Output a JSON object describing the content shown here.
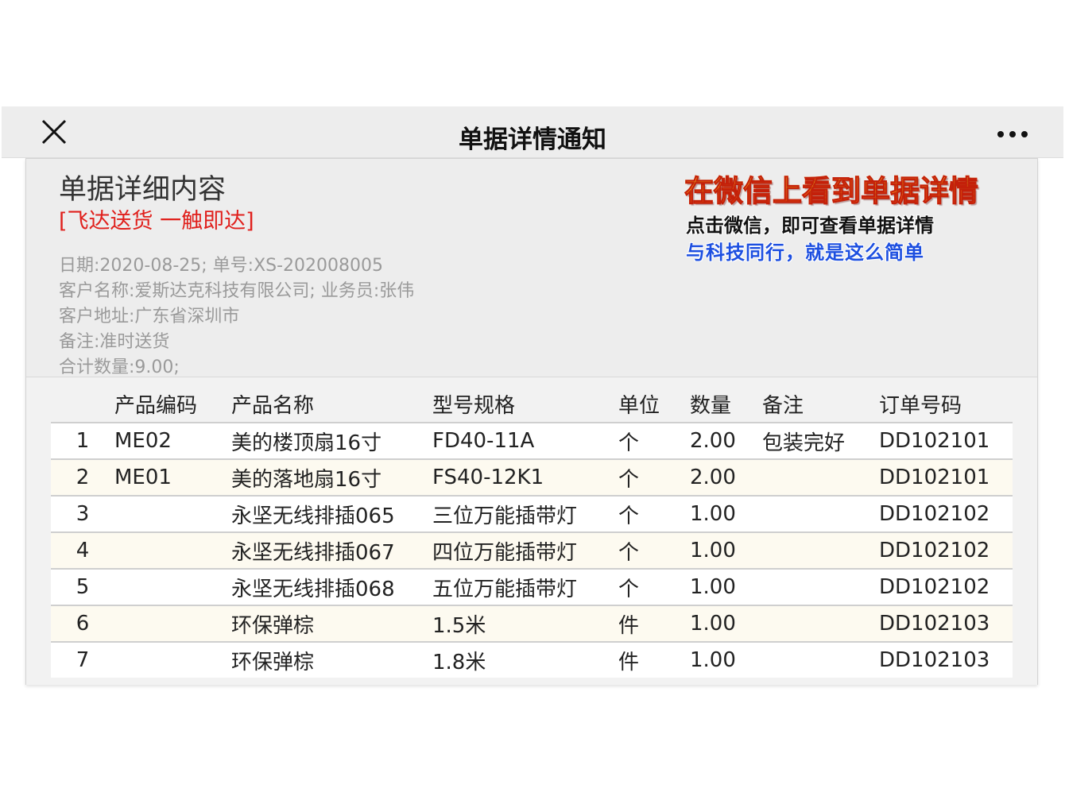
{
  "topbar": {
    "title": "单据详情通知"
  },
  "card": {
    "title": "单据详细内容",
    "slogan": "[飞达送货 一触即达]",
    "info_lines": [
      "日期:2020-08-25; 单号:XS-202008005",
      "客户名称:爱斯达克科技有限公司; 业务员:张伟",
      "客户地址:广东省深圳市",
      "备注:准时送货",
      "合计数量:9.00;"
    ]
  },
  "promo": {
    "headline": "在微信上看到单据详情",
    "line1": "点击微信，即可查看单据详情",
    "line2": "与科技同行，就是这么简单"
  },
  "table": {
    "headers": [
      "",
      "产品编码",
      "产品名称",
      "型号规格",
      "单位",
      "数量",
      "备注",
      "订单号码"
    ],
    "rows": [
      [
        "1",
        "ME02",
        "美的楼顶扇16寸",
        "FD40-11A",
        "个",
        "2.00",
        "包装完好",
        "DD102101"
      ],
      [
        "2",
        "ME01",
        "美的落地扇16寸",
        "FS40-12K1",
        "个",
        "2.00",
        "",
        "DD102101"
      ],
      [
        "3",
        "",
        "永坚无线排插065",
        "三位万能插带灯",
        "个",
        "1.00",
        "",
        "DD102102"
      ],
      [
        "4",
        "",
        "永坚无线排插067",
        "四位万能插带灯",
        "个",
        "1.00",
        "",
        "DD102102"
      ],
      [
        "5",
        "",
        "永坚无线排插068",
        "五位万能插带灯",
        "个",
        "1.00",
        "",
        "DD102102"
      ],
      [
        "6",
        "",
        "环保弹棕",
        "1.5米",
        "件",
        "1.00",
        "",
        "DD102103"
      ],
      [
        "7",
        "",
        "环保弹棕",
        "1.8米",
        "件",
        "1.00",
        "",
        "DD102103"
      ]
    ]
  },
  "colors": {
    "slogan": "#e0201c",
    "promo_blue": "#1d4fe0",
    "promo_orange": "#ff7a1a"
  },
  "icons": {
    "close": "close-icon",
    "more": "more-dots-icon"
  }
}
